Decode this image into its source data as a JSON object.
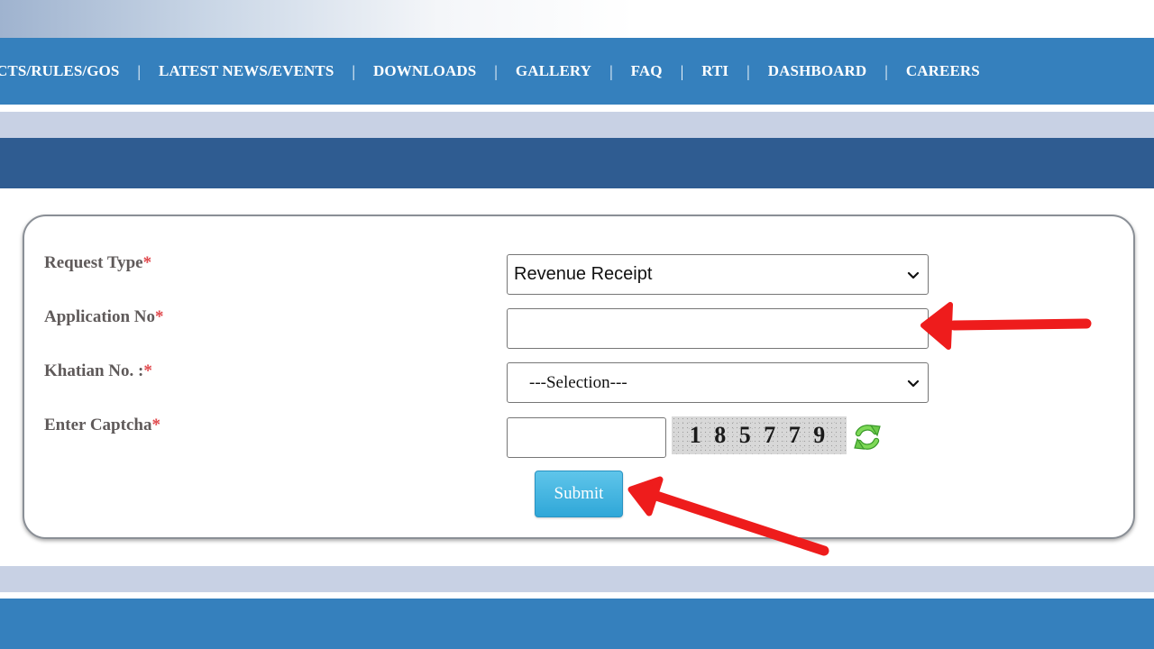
{
  "nav": {
    "items": [
      "CTS/RULES/GOS",
      "LATEST NEWS/EVENTS",
      "DOWNLOADS",
      "GALLERY",
      "FAQ",
      "RTI",
      "DASHBOARD",
      "CAREERS"
    ],
    "separator": "|"
  },
  "form": {
    "request_type": {
      "label": "Request Type",
      "required": "*",
      "value": "Revenue Receipt"
    },
    "application_no": {
      "label": "Application No",
      "required": "*",
      "value": ""
    },
    "khatian_no": {
      "label": "Khatian No. :",
      "required": "*",
      "value": "---Selection---"
    },
    "captcha": {
      "label": "Enter Captcha",
      "required": "*",
      "value": "",
      "image_text": "1 8 5 7 7 9"
    },
    "submit_label": "Submit"
  },
  "colors": {
    "nav_bg": "#3580bd",
    "header_band": "#2f5c91",
    "light_band": "#c8d1e4",
    "required": "#e0464a",
    "submit_bg": "#3db3e0",
    "annotation_arrow": "#ee1c1c"
  },
  "icons": {
    "refresh": "refresh-captcha-icon",
    "dropdown": "chevron-down-icon"
  }
}
